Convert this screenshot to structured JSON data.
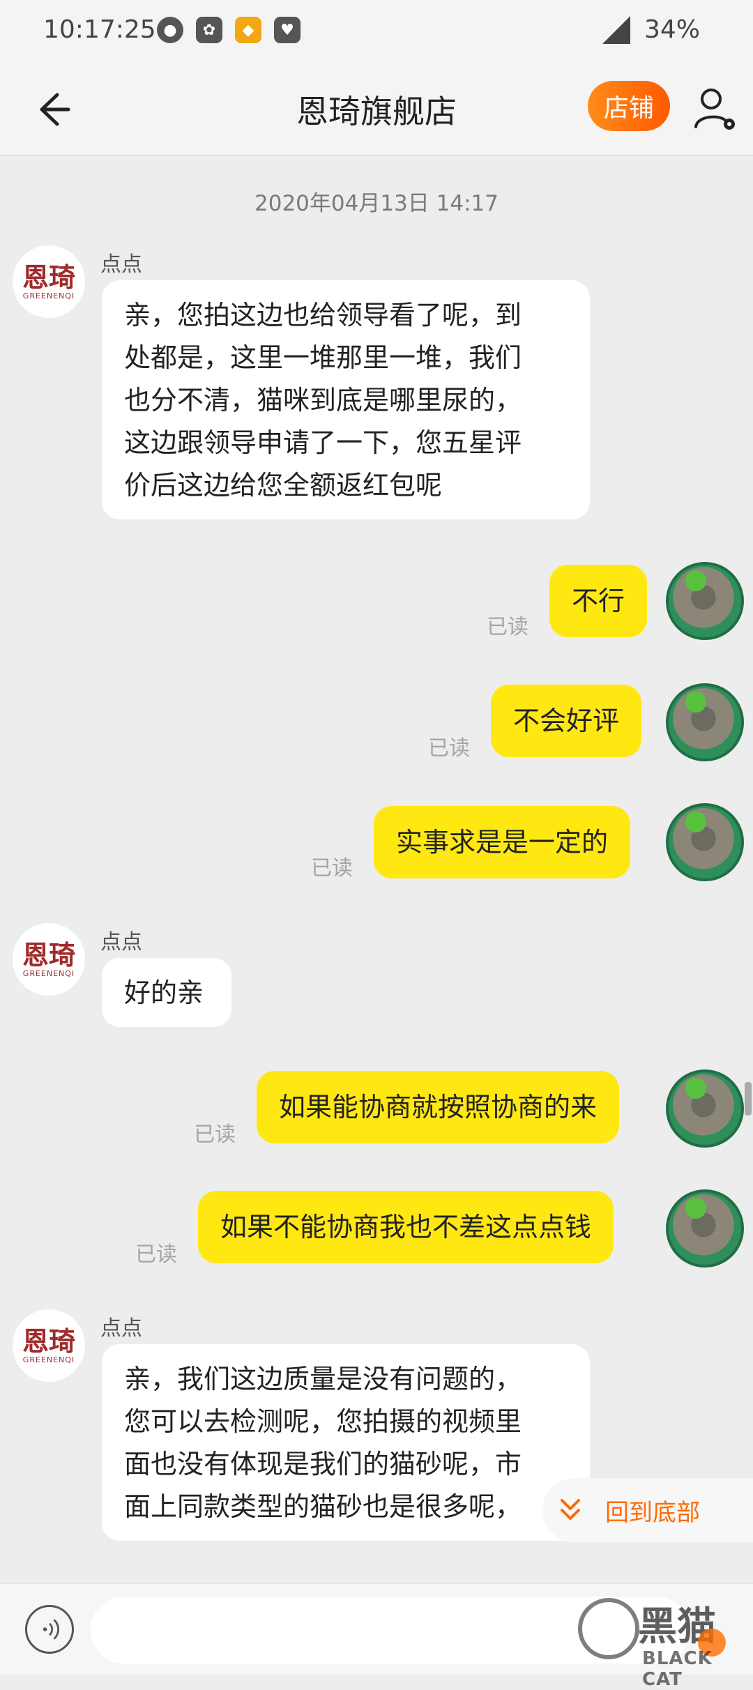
{
  "status_bar": {
    "time": "10:17:25",
    "battery": "34%",
    "icons": [
      "app-icon-1",
      "paw-app-icon",
      "squirrel-app-icon",
      "heart-app-icon"
    ]
  },
  "header": {
    "title": "恩琦旗舰店",
    "shop_button": "店铺"
  },
  "chat": {
    "timestamp": "2020年04月13日 14:17",
    "shop_logo": {
      "cn": "恩琦",
      "en": "GREENENQI"
    },
    "messages": [
      {
        "side": "left",
        "sender": "点点",
        "text": [
          "亲，您拍这边也给领导看了呢，到",
          "处都是，这里一堆那里一堆，我们",
          "也分不清，猫咪到底是哪里尿的，",
          "这边跟领导申请了一下，您五星评",
          "价后这边给您全额返红包呢"
        ]
      },
      {
        "side": "right",
        "text": "不行",
        "status": "已读"
      },
      {
        "side": "right",
        "text": "不会好评",
        "status": "已读"
      },
      {
        "side": "right",
        "text": "实事求是是一定的",
        "status": "已读"
      },
      {
        "side": "left",
        "sender": "点点",
        "text": [
          "好的亲"
        ]
      },
      {
        "side": "right",
        "text": "如果能协商就按照协商的来",
        "status": "已读"
      },
      {
        "side": "right",
        "text": "如果不能协商我也不差这点点钱",
        "status": "已读"
      },
      {
        "side": "left",
        "sender": "点点",
        "text": [
          "亲，我们这边质量是没有问题的，",
          "您可以去检测呢，您拍摄的视频里",
          "面也没有体现是我们的猫砂呢，市",
          "面上同款类型的猫砂也是很多呢，"
        ]
      }
    ],
    "back_to_bottom": "回到底部"
  },
  "input": {
    "value": "",
    "placeholder": ""
  },
  "watermark": {
    "cn": "黑猫",
    "en": "BLACK CAT"
  },
  "colors": {
    "accent": "#ff6a00",
    "own_bubble": "#ffe812",
    "background": "#ededed"
  }
}
